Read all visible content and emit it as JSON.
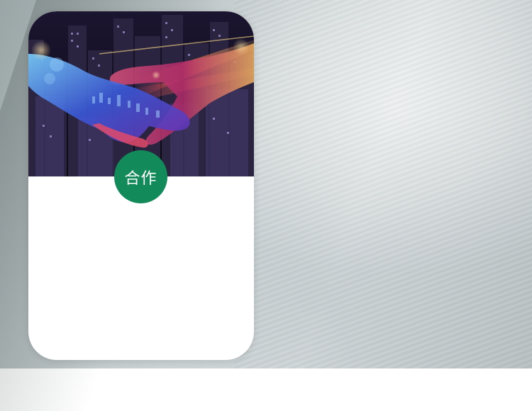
{
  "card": {
    "badge_label": "合作",
    "badge_color": "#138a5a",
    "hero_image": "handshake-city-image"
  }
}
